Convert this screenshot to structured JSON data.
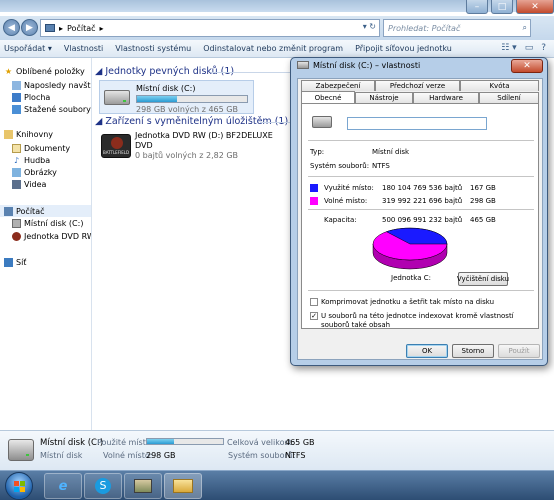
{
  "explorer": {
    "address": {
      "root_icon": "computer-icon",
      "segment": "Počítač",
      "arrow": "▸"
    },
    "search": {
      "placeholder": "Prohledat: Počítač"
    },
    "commands": [
      "Uspořádat ▾",
      "Vlastnosti",
      "Vlastnosti systému",
      "Odinstalovat nebo změnit program",
      "Připojit síťovou jednotku"
    ],
    "nav": {
      "favorites_header": "Oblíbené položky",
      "favorites": [
        "Naposledy navštíven",
        "Plocha",
        "Stažené soubory"
      ],
      "libraries_header": "Knihovny",
      "libraries": [
        "Dokumenty",
        "Hudba",
        "Obrázky",
        "Videa"
      ],
      "computer_header": "Počítač",
      "computer_items": [
        "Místní disk (C:)",
        "Jednotka DVD RW (D"
      ],
      "network": "Síť"
    },
    "groups": {
      "hard_disks": "Jednotky pevných disků (1)",
      "removable": "Zařízení s vyměnitelným úložištěm (1)"
    },
    "drive_c": {
      "name": "Místní disk (C:)",
      "free_text": "298 GB volných z 465 GB",
      "used_fraction": 0.36
    },
    "drive_d": {
      "name": "Jednotka DVD RW (D:) BF2DELUXE",
      "type": "DVD",
      "free_text": "0 bajtů volných z 2,82 GB",
      "logo_text": "BATTLEFIELD"
    },
    "details": {
      "name": "Místní disk (C:)",
      "type": "Místní disk",
      "used_label": "Použité místo:",
      "used_fraction": 0.36,
      "free_label": "Volné místo:",
      "free_value": "298 GB",
      "total_label": "Celková velikost:",
      "total_value": "465 GB",
      "fs_label": "Systém souborů:",
      "fs_value": "NTFS"
    }
  },
  "dialog": {
    "title": "Místní disk (C:) – vlastnosti",
    "close": "✕",
    "tabs_row1": [
      "Zabezpečení",
      "Předchozí verze",
      "Kvóta"
    ],
    "tabs_row2": [
      "Obecné",
      "Nástroje",
      "Hardware",
      "Sdílení"
    ],
    "type_label": "Typ:",
    "type_value": "Místní disk",
    "fs_label": "Systém souborů:",
    "fs_value": "NTFS",
    "used_label": "Využité místo:",
    "used_bytes": "180 104 769 536 bajtů",
    "used_gb": "167 GB",
    "free_label": "Volné místo:",
    "free_bytes": "319 992 221 696 bajtů",
    "free_gb": "298 GB",
    "capacity_label": "Kapacita:",
    "capacity_bytes": "500 096 991 232 bajtů",
    "capacity_gb": "465 GB",
    "drive_label": "Jednotka C:",
    "cleanup_button": "Vyčištění disku",
    "compress_label": "Komprimovat jednotku a šetřit tak místo na disku",
    "index_label_1": "U souborů na této jednotce indexovat kromě vlastností",
    "index_label_2": "souborů také obsah",
    "ok": "OK",
    "cancel": "Storno",
    "apply": "Použít",
    "colors": {
      "used": "#1a1aff",
      "free": "#ff00ff"
    },
    "pie": {
      "used_fraction": 0.36
    }
  }
}
